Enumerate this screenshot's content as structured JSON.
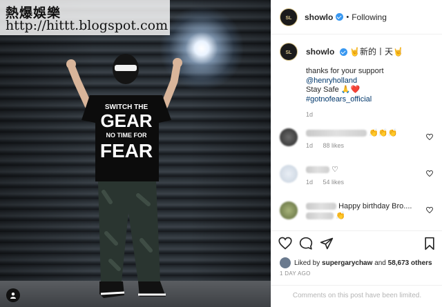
{
  "watermark": {
    "line1": "熱爆娛樂",
    "line2": "http://hittt.blogspot.com"
  },
  "photo": {
    "shirt_lines": [
      "SWITCH THE",
      "GEAR",
      "NO TIME FOR",
      "FEAR"
    ]
  },
  "header": {
    "username": "showlo",
    "separator": "•",
    "follow_status": "Following"
  },
  "caption": {
    "username": "showlo",
    "title": "🤘新的丨天🤘",
    "lines": [
      "thanks for your support",
      "@henryholland",
      "Stay Safe 🙏❤️",
      "#gotnofears_official"
    ],
    "time": "1d"
  },
  "comments": [
    {
      "text_suffix": "👏👏👏",
      "time": "1d",
      "likes": "88 likes"
    },
    {
      "text_suffix": "♡",
      "time": "1d",
      "likes": "54 likes"
    },
    {
      "text_suffix": "Happy birthday Bro....",
      "text_line2": "👏",
      "time": "",
      "likes": ""
    }
  ],
  "likes": {
    "prefix": "Liked by",
    "user": "supergarychaw",
    "connector": "and",
    "others": "58,673 others"
  },
  "time_ago": "1 DAY AGO",
  "comments_limited": "Comments on this post have been limited.",
  "colors": {
    "link": "#00376b",
    "verified": "#3897f0",
    "muted": "#8e8e8e"
  }
}
